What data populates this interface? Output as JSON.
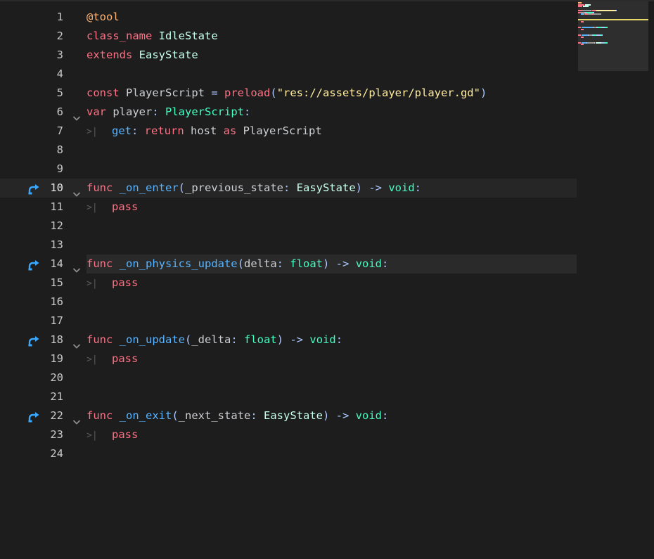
{
  "editor": {
    "language": "GDScript",
    "current_line": 10,
    "selected_line": 14,
    "lines": [
      {
        "n": "1",
        "tokens": [
          {
            "t": "@tool",
            "c": "ann"
          }
        ]
      },
      {
        "n": "2",
        "tokens": [
          {
            "t": "class_name",
            "c": "kw"
          },
          {
            "t": " ",
            "c": "txt"
          },
          {
            "t": "IdleState",
            "c": "cls"
          }
        ]
      },
      {
        "n": "3",
        "tokens": [
          {
            "t": "extends",
            "c": "kw"
          },
          {
            "t": " ",
            "c": "txt"
          },
          {
            "t": "EasyState",
            "c": "cls"
          }
        ]
      },
      {
        "n": "4",
        "tokens": []
      },
      {
        "n": "5",
        "tokens": [
          {
            "t": "const",
            "c": "kw"
          },
          {
            "t": " PlayerScript ",
            "c": "txt"
          },
          {
            "t": "=",
            "c": "sym"
          },
          {
            "t": " ",
            "c": "txt"
          },
          {
            "t": "preload",
            "c": "kw"
          },
          {
            "t": "(",
            "c": "sym"
          },
          {
            "t": "\"res://assets/player/player.gd\"",
            "c": "str"
          },
          {
            "t": ")",
            "c": "sym"
          }
        ]
      },
      {
        "n": "6",
        "fold": true,
        "tokens": [
          {
            "t": "var",
            "c": "kw"
          },
          {
            "t": " player",
            "c": "txt"
          },
          {
            "t": ": ",
            "c": "sym"
          },
          {
            "t": "PlayerScript",
            "c": "type"
          },
          {
            "t": ":",
            "c": "sym"
          }
        ]
      },
      {
        "n": "7",
        "tab": true,
        "tokens": [
          {
            "t": "get",
            "c": "fn"
          },
          {
            "t": ": ",
            "c": "sym"
          },
          {
            "t": "return",
            "c": "kw"
          },
          {
            "t": " host ",
            "c": "txt"
          },
          {
            "t": "as",
            "c": "kw"
          },
          {
            "t": " PlayerScript",
            "c": "txt"
          }
        ]
      },
      {
        "n": "8",
        "tokens": []
      },
      {
        "n": "9",
        "tokens": []
      },
      {
        "n": "10",
        "fold": true,
        "override": true,
        "tokens": [
          {
            "t": "func",
            "c": "kw"
          },
          {
            "t": " ",
            "c": "txt"
          },
          {
            "t": "_on_enter",
            "c": "fn"
          },
          {
            "t": "(",
            "c": "sym"
          },
          {
            "t": "_previous_state",
            "c": "txt"
          },
          {
            "t": ": ",
            "c": "sym"
          },
          {
            "t": "EasyState",
            "c": "cls"
          },
          {
            "t": ") -> ",
            "c": "sym"
          },
          {
            "t": "void",
            "c": "type"
          },
          {
            "t": ":",
            "c": "sym"
          }
        ]
      },
      {
        "n": "11",
        "tab": true,
        "tokens": [
          {
            "t": "pass",
            "c": "kw"
          }
        ]
      },
      {
        "n": "12",
        "tokens": []
      },
      {
        "n": "13",
        "tokens": []
      },
      {
        "n": "14",
        "fold": true,
        "override": true,
        "tokens": [
          {
            "t": "func",
            "c": "kw"
          },
          {
            "t": " ",
            "c": "txt"
          },
          {
            "t": "_on_physics_update",
            "c": "fn"
          },
          {
            "t": "(",
            "c": "sym"
          },
          {
            "t": "delta",
            "c": "txt"
          },
          {
            "t": ": ",
            "c": "sym"
          },
          {
            "t": "float",
            "c": "type"
          },
          {
            "t": ") -> ",
            "c": "sym"
          },
          {
            "t": "void",
            "c": "type"
          },
          {
            "t": ":",
            "c": "sym"
          }
        ]
      },
      {
        "n": "15",
        "tab": true,
        "tokens": [
          {
            "t": "pass",
            "c": "kw"
          }
        ]
      },
      {
        "n": "16",
        "tokens": []
      },
      {
        "n": "17",
        "tokens": []
      },
      {
        "n": "18",
        "fold": true,
        "override": true,
        "tokens": [
          {
            "t": "func",
            "c": "kw"
          },
          {
            "t": " ",
            "c": "txt"
          },
          {
            "t": "_on_update",
            "c": "fn"
          },
          {
            "t": "(",
            "c": "sym"
          },
          {
            "t": "_delta",
            "c": "txt"
          },
          {
            "t": ": ",
            "c": "sym"
          },
          {
            "t": "float",
            "c": "type"
          },
          {
            "t": ") -> ",
            "c": "sym"
          },
          {
            "t": "void",
            "c": "type"
          },
          {
            "t": ":",
            "c": "sym"
          }
        ]
      },
      {
        "n": "19",
        "tab": true,
        "tokens": [
          {
            "t": "pass",
            "c": "kw"
          }
        ]
      },
      {
        "n": "20",
        "tokens": []
      },
      {
        "n": "21",
        "tokens": []
      },
      {
        "n": "22",
        "fold": true,
        "override": true,
        "tokens": [
          {
            "t": "func",
            "c": "kw"
          },
          {
            "t": " ",
            "c": "txt"
          },
          {
            "t": "_on_exit",
            "c": "fn"
          },
          {
            "t": "(",
            "c": "sym"
          },
          {
            "t": "_next_state",
            "c": "txt"
          },
          {
            "t": ": ",
            "c": "sym"
          },
          {
            "t": "EasyState",
            "c": "cls"
          },
          {
            "t": ") -> ",
            "c": "sym"
          },
          {
            "t": "void",
            "c": "type"
          },
          {
            "t": ":",
            "c": "sym"
          }
        ]
      },
      {
        "n": "23",
        "tab": true,
        "tokens": [
          {
            "t": "pass",
            "c": "kw"
          }
        ]
      },
      {
        "n": "24",
        "tokens": []
      }
    ]
  },
  "icons": {
    "override": "override-method-icon",
    "fold": "fold-chevron-icon",
    "tab": "tab-indent-icon"
  },
  "colors": {
    "background": "#1d1d1d",
    "keyword": "#ff7085",
    "annotation": "#ffb373",
    "class": "#c7ffed",
    "type": "#42ffc2",
    "function": "#57b3ff",
    "string": "#ffeda1",
    "symbol": "#abc8ff",
    "override_icon": "#3aa8ff"
  }
}
